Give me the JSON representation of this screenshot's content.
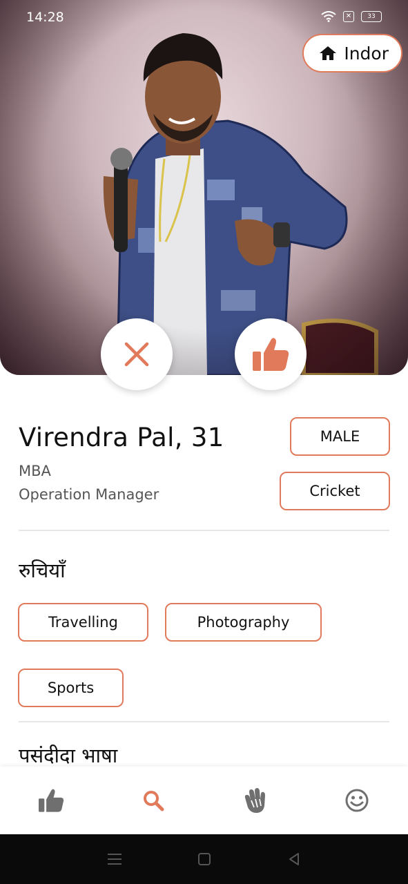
{
  "status_bar": {
    "time": "14:28",
    "battery": "33"
  },
  "location": {
    "label": "Indor",
    "icon": "home-icon"
  },
  "actions": {
    "reject_icon": "close-icon",
    "like_icon": "thumbs-up-icon"
  },
  "profile": {
    "name_age": "Virendra Pal, 31",
    "education": "MBA",
    "occupation": "Operation Manager",
    "gender": "MALE",
    "sport": "Cricket"
  },
  "interests": {
    "title": "रुचियाँ",
    "items": [
      "Travelling",
      "Photography",
      "Sports"
    ]
  },
  "languages": {
    "title": "पसंदीदा भाषा"
  },
  "bottom_nav": {
    "items": [
      "thumbs-up-icon",
      "search-icon",
      "wave-hand-icon",
      "smiley-icon"
    ],
    "active_index": 1
  },
  "colors": {
    "accent": "#e07a5a",
    "nav_inactive": "#6f6f6f"
  }
}
